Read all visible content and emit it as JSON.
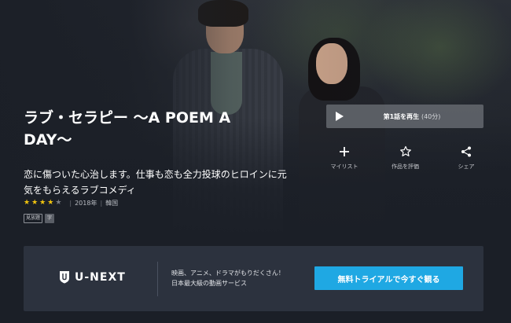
{
  "title": "ラブ・セラピー 〜A POEM A DAY〜",
  "description": "恋に傷ついた心治します。仕事も恋も全力投球のヒロインに元気をもらえるラブコメディ",
  "meta": {
    "rating": 4,
    "rating_max": 5,
    "year": "2018年",
    "country": "韓国"
  },
  "badges": [
    "見放題",
    "字"
  ],
  "play": {
    "label": "第1話を再生",
    "duration": "(40分)"
  },
  "actions": [
    {
      "label": "マイリスト",
      "icon": "plus-icon"
    },
    {
      "label": "作品を評価",
      "icon": "star-outline-icon"
    },
    {
      "label": "シェア",
      "icon": "share-icon"
    }
  ],
  "banner": {
    "brand": "U-NEXT",
    "line1": "映画、アニメ、ドラマがもりだくさん！",
    "line2": "日本最大級の動画サービス",
    "cta": "無料トライアルで今すぐ観る"
  },
  "colors": {
    "cta": "#1fa8e3",
    "star": "#f1c40f",
    "banner_bg": "#2c323e",
    "page_bg": "#1b1f27"
  }
}
